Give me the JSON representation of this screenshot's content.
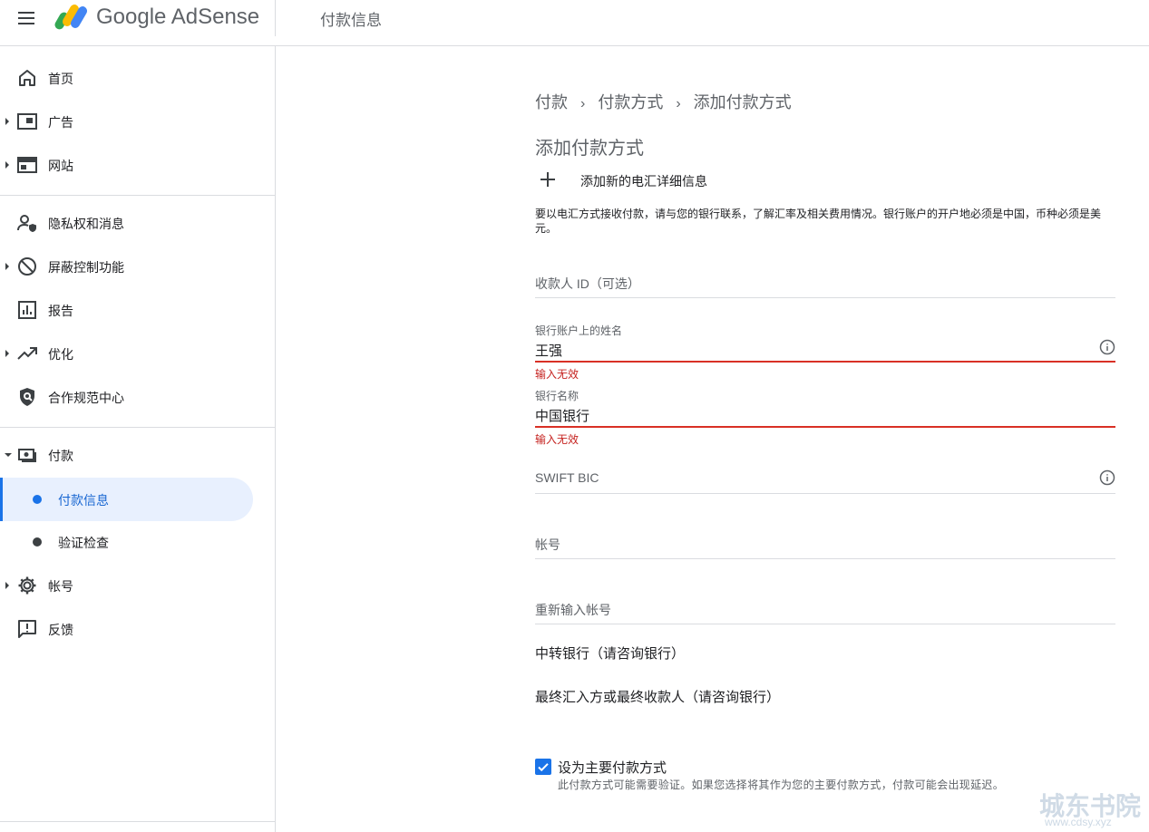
{
  "header": {
    "brand": "Google AdSense",
    "page_title": "付款信息"
  },
  "sidebar": {
    "items": [
      {
        "label": "首页",
        "icon": "home-icon"
      },
      {
        "label": "广告",
        "icon": "ads-icon"
      },
      {
        "label": "网站",
        "icon": "sites-icon"
      },
      {
        "label": "隐私权和消息",
        "icon": "privacy-icon"
      },
      {
        "label": "屏蔽控制功能",
        "icon": "block-icon"
      },
      {
        "label": "报告",
        "icon": "reports-icon"
      },
      {
        "label": "优化",
        "icon": "optimize-icon"
      },
      {
        "label": "合作规范中心",
        "icon": "policy-icon"
      },
      {
        "label": "付款",
        "icon": "payments-icon"
      },
      {
        "label": "帐号",
        "icon": "gear-icon"
      },
      {
        "label": "反馈",
        "icon": "feedback-icon"
      }
    ],
    "payments_sub": [
      {
        "label": "付款信息",
        "active": true
      },
      {
        "label": "验证检查",
        "active": false
      }
    ]
  },
  "breadcrumb": [
    "付款",
    "付款方式",
    "添加付款方式"
  ],
  "form": {
    "section_title": "添加付款方式",
    "add_new_label": "添加新的电汇详细信息",
    "notice": "要以电汇方式接收付款，请与您的银行联系，了解汇率及相关费用情况。银行账户的开户地必须是中国，币种必须是美元。",
    "payee_id_placeholder": "收款人 ID（可选）",
    "account_name_label": "银行账户上的姓名",
    "account_name_value": "王强",
    "account_name_error": "输入无效",
    "bank_name_label": "银行名称",
    "bank_name_value": "中国银行",
    "bank_name_error": "输入无效",
    "swift_placeholder": "SWIFT BIC",
    "account_number_placeholder": "帐号",
    "account_number_confirm_placeholder": "重新输入帐号",
    "intermediary_bank": "中转银行（请咨询银行）",
    "final_beneficiary": "最终汇入方或最终收款人（请咨询银行）",
    "primary_checkbox_label": "设为主要付款方式",
    "primary_checkbox_checked": true,
    "primary_checkbox_hint": "此付款方式可能需要验证。如果您选择将其作为您的主要付款方式，付款可能会出现延迟。"
  },
  "watermark": {
    "text": "城东书院",
    "sub": "www.cdsy.xyz"
  },
  "colors": {
    "accent": "#1a73e8",
    "error": "#d93025",
    "active_bg": "#e8f0fe"
  }
}
